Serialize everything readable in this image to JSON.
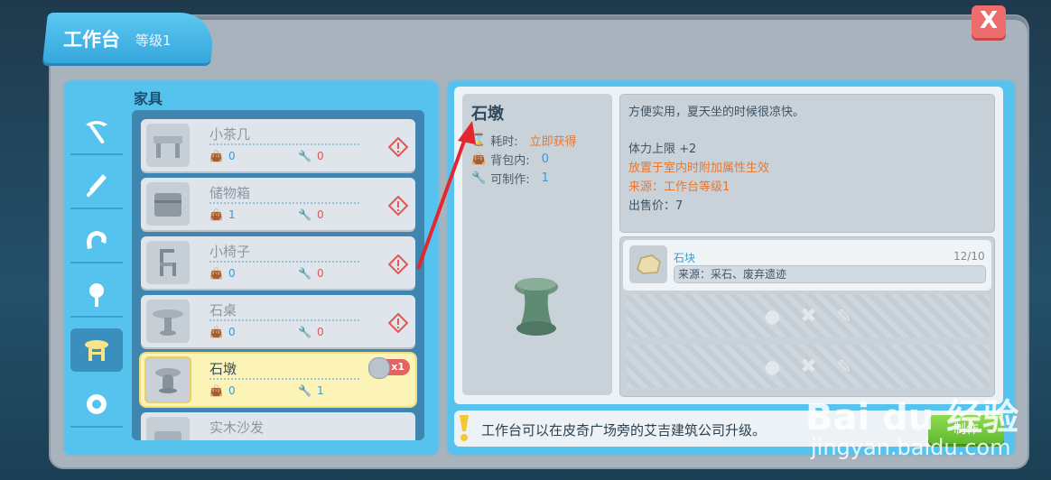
{
  "window": {
    "title": "工作台",
    "level": "等级1",
    "close_label": "X"
  },
  "category": {
    "title": "家具"
  },
  "categories": [
    {
      "icon": "pickaxe-icon",
      "active": false
    },
    {
      "icon": "sword-icon",
      "active": false
    },
    {
      "icon": "horseshoe-icon",
      "active": false
    },
    {
      "icon": "flower-icon",
      "active": false
    },
    {
      "icon": "furniture-icon",
      "active": true
    },
    {
      "icon": "gear-icon",
      "active": false
    }
  ],
  "items": [
    {
      "name": "小茶几",
      "bag": "0",
      "craftable": "0",
      "warning": true
    },
    {
      "name": "储物箱",
      "bag": "1",
      "craftable": "0",
      "warning": true
    },
    {
      "name": "小椅子",
      "bag": "0",
      "craftable": "0",
      "warning": true
    },
    {
      "name": "石桌",
      "bag": "0",
      "craftable": "0",
      "warning": true
    },
    {
      "name": "石墩",
      "bag": "0",
      "craftable": "1",
      "warning": false,
      "selected": true,
      "badge": "x1"
    },
    {
      "name": "实木沙发",
      "bag": "",
      "craftable": "",
      "warning": false
    }
  ],
  "detail": {
    "name": "石墩",
    "time_label": "耗时:",
    "time_value": "立即获得",
    "bag_label": "背包内:",
    "bag_value": "0",
    "craft_label": "可制作:",
    "craft_value": "1"
  },
  "description": {
    "line1": "方便实用，夏天坐的时候很凉快。",
    "line2": "体力上限 +2",
    "line3": "放置于室内时附加属性生效",
    "line4": "来源：工作台等级1",
    "line5": "出售价：7"
  },
  "materials": [
    {
      "name": "石块",
      "count": "12/10",
      "source": "来源：采石、废弃遗迹"
    }
  ],
  "tip": {
    "text": "工作台可以在皮奇广场旁的艾吉建筑公司升级。"
  },
  "make_button": {
    "label": "制作"
  },
  "watermark": {
    "logo": "Bai du 经验",
    "url": "jingyan.baidu.com"
  },
  "colors": {
    "accent": "#56c3ef",
    "warning": "#e25656",
    "orange": "#e8782f",
    "make": "#6cc63a"
  }
}
